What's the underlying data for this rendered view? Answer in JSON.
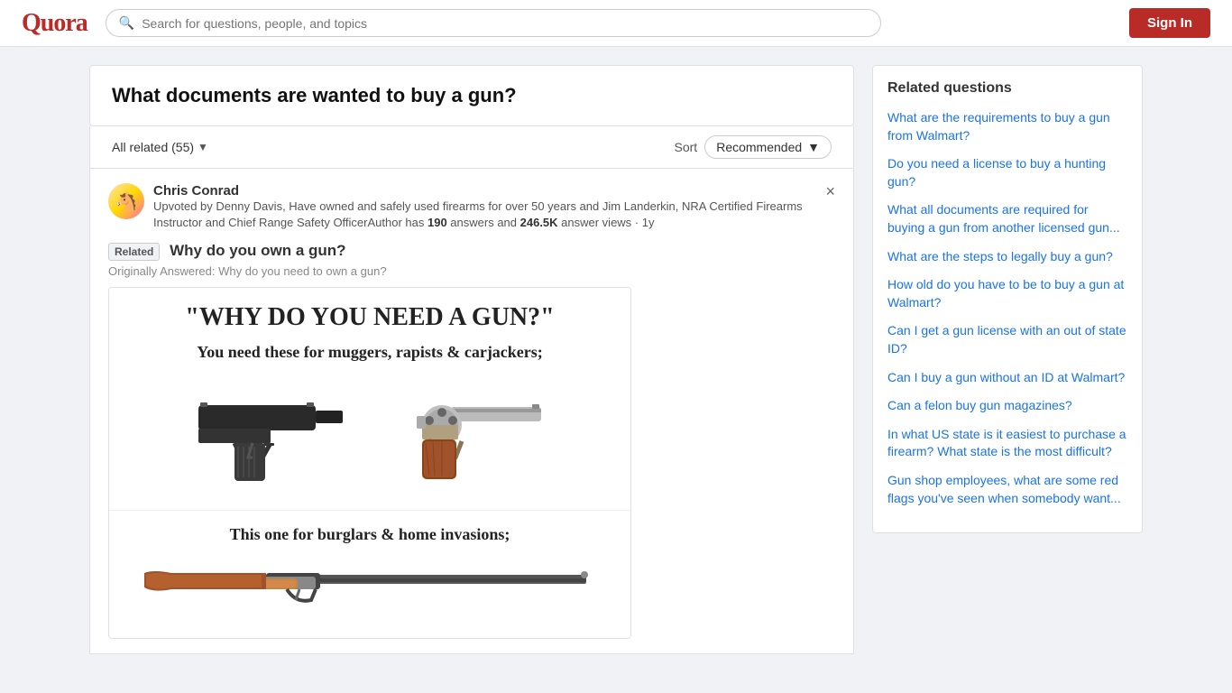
{
  "header": {
    "logo": "Quora",
    "search_placeholder": "Search for questions, people, and topics",
    "sign_in_label": "Sign In"
  },
  "question": {
    "title": "What documents are wanted to buy a gun?"
  },
  "answers_bar": {
    "all_related_label": "All related (55)",
    "sort_label": "Sort",
    "sort_option": "Recommended"
  },
  "answer": {
    "author_name": "Chris Conrad",
    "author_bio_prefix": "Upvoted by Denny Davis, Have owned and safely used firearms for over 50 years and Jim Landerkin, NRA Certified Firearms Instructor and Chief Range Safety OfficerAuthor has ",
    "author_answers_count": "190",
    "author_bio_middle": " answers and ",
    "author_views_count": "246.5K",
    "author_bio_suffix": " answer views · 1y",
    "related_tag": "Related",
    "related_question": "Why do you own a gun?",
    "originally_answered": "Originally Answered: Why do you need to own a gun?",
    "meme_title": "\"WHY DO YOU NEED A GUN?\"",
    "meme_subtitle1": "You need these for muggers, rapists & carjackers;",
    "meme_subtitle2": "This one for burglars & home invasions;"
  },
  "sidebar": {
    "title": "Related questions",
    "items": [
      {
        "text": "What are the requirements to buy a gun from Walmart?"
      },
      {
        "text": "Do you need a license to buy a hunting gun?"
      },
      {
        "text": "What all documents are required for buying a gun from another licensed gun..."
      },
      {
        "text": "What are the steps to legally buy a gun?"
      },
      {
        "text": "How old do you have to be to buy a gun at Walmart?"
      },
      {
        "text": "Can I get a gun license with an out of state ID?"
      },
      {
        "text": "Can I buy a gun without an ID at Walmart?"
      },
      {
        "text": "Can a felon buy gun magazines?"
      },
      {
        "text": "In what US state is it easiest to purchase a firearm? What state is the most difficult?"
      },
      {
        "text": "Gun shop employees, what are some red flags you've seen when somebody want..."
      }
    ]
  }
}
